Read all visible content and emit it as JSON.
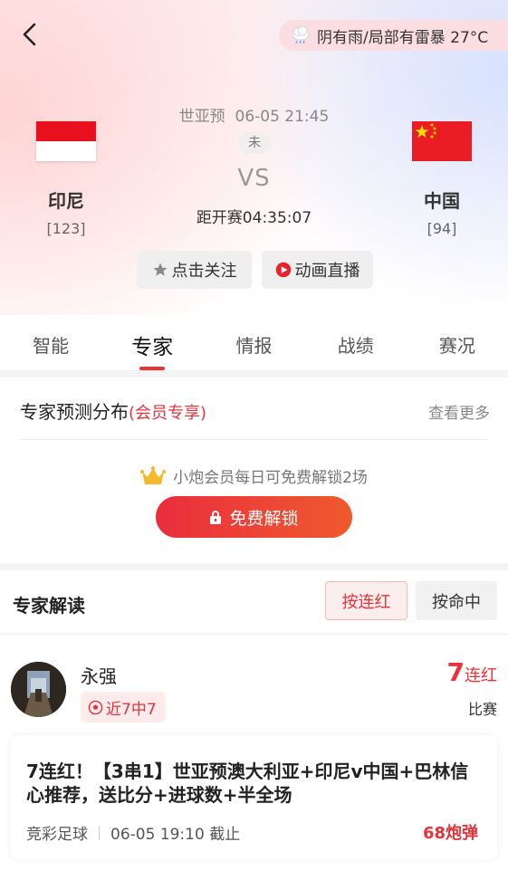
{
  "weather": {
    "text": "阴有雨/局部有雷暴 27°C",
    "icon": "cloud-rain-icon"
  },
  "match": {
    "league": "世亚预",
    "datetime": "06-05 21:45",
    "status": "未",
    "vs": "VS",
    "countdown": "距开赛04:35:07",
    "home": {
      "name": "印尼",
      "rank": "[123]"
    },
    "away": {
      "name": "中国",
      "rank": "[94]"
    }
  },
  "actions": {
    "follow": "点击关注",
    "live": "动画直播"
  },
  "tabs": [
    "智能",
    "专家",
    "情报",
    "战绩",
    "赛况"
  ],
  "active_tab": "专家",
  "prediction": {
    "title": "专家预测分布",
    "vip_tag": "(会员专享)",
    "more": "查看更多",
    "hint": "小炮会员每日可免费解锁2场",
    "unlock": "免费解锁"
  },
  "experts": {
    "title": "专家解读",
    "sort_by_streak": "按连红",
    "sort_by_hit": "按命中",
    "item": {
      "name": "永强",
      "badge": "近7中7",
      "streak_num": "7",
      "streak_label": "连红",
      "sub": "比赛",
      "article_title": "7连红！【3串1】世亚预澳大利亚+印尼v中国+巴林信心推荐，送比分+进球数+半全场",
      "category": "竞彩足球",
      "deadline": "06-05 19:10 截止",
      "price": "68炮弹"
    }
  },
  "colors": {
    "accent": "#e8333b",
    "vip_gradient_start": "#ea2d3d",
    "vip_gradient_end": "#ef5a2e"
  }
}
